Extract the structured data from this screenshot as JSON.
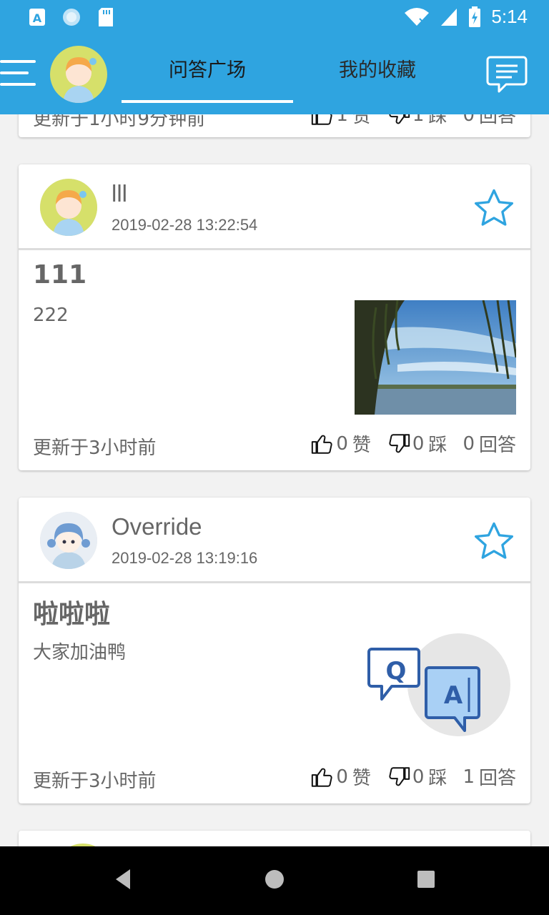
{
  "status_bar": {
    "time": "5:14",
    "icons": [
      "keyboard-a-icon",
      "sync-circle-icon",
      "sd-card-icon",
      "wifi-icon",
      "signal-icon",
      "battery-charging-icon"
    ]
  },
  "header": {
    "tabs": [
      {
        "label": "问答广场",
        "active": true
      },
      {
        "label": "我的收藏",
        "active": false
      }
    ],
    "accent_color": "#2fa4e0"
  },
  "partial_card_top": {
    "updated": "更新于1小时9分钟前",
    "likes": "1",
    "like_label": "赞",
    "dislikes": "1",
    "dislike_label": "踩",
    "answers": "0",
    "answer_label": "回答"
  },
  "questions": [
    {
      "username": "lll",
      "date": "2019-02-28 13:22:54",
      "title": "111",
      "text": "222",
      "image": "lake-willow-photo",
      "updated": "更新于3小时前",
      "likes": "0",
      "like_label": "赞",
      "dislikes": "0",
      "dislike_label": "踩",
      "answers": "0",
      "answer_label": "回答"
    },
    {
      "username": "Override",
      "date": "2019-02-28 13:19:16",
      "title": "啦啦啦",
      "text": "大家加油鸭",
      "image": "qa-illustration",
      "updated": "更新于3小时前",
      "likes": "0",
      "like_label": "赞",
      "dislikes": "0",
      "dislike_label": "踩",
      "answers": "1",
      "answer_label": "回答"
    }
  ]
}
